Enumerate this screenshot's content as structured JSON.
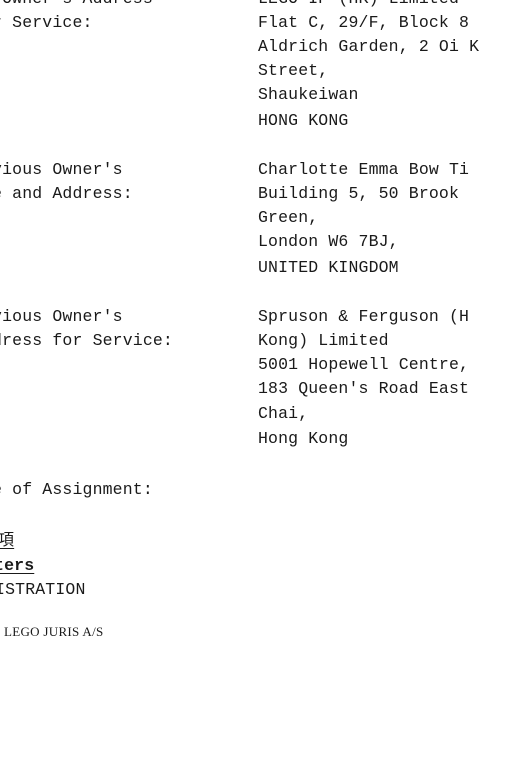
{
  "new_owner": {
    "label_line1": "w Owner's Address",
    "label_line2": "or Service:",
    "name_line": "LEGO IP (HK) Limited",
    "address": [
      "Flat C, 29/F, Block 8",
      "Aldrich Garden, 2 Oi K",
      "Street,",
      "Shaukeiwan",
      "HONG KONG"
    ]
  },
  "previous_owner": {
    "label_line1": "evious Owner's",
    "label_line2": "me and Address:",
    "address": [
      "Charlotte Emma Bow Ti",
      "Building 5, 50 Brook",
      "Green,",
      "London W6 7BJ,",
      "UNITED KINGDOM"
    ]
  },
  "previous_owner_service": {
    "label_line1": "evious Owner's",
    "label_line2": "ddress for Service:",
    "address": [
      "Spruson & Ferguson (H",
      "Kong) Limited",
      "5001 Hopewell Centre,",
      "183 Queen's Road East",
      "Chai,",
      "Hong Kong"
    ]
  },
  "assignment": {
    "label": "te of Assignment:"
  },
  "section": {
    "chinese": "項",
    "heading": "tters",
    "subheading": "GISTRATION"
  },
  "footer": {
    "text": "LEGO JURIS A/S"
  }
}
